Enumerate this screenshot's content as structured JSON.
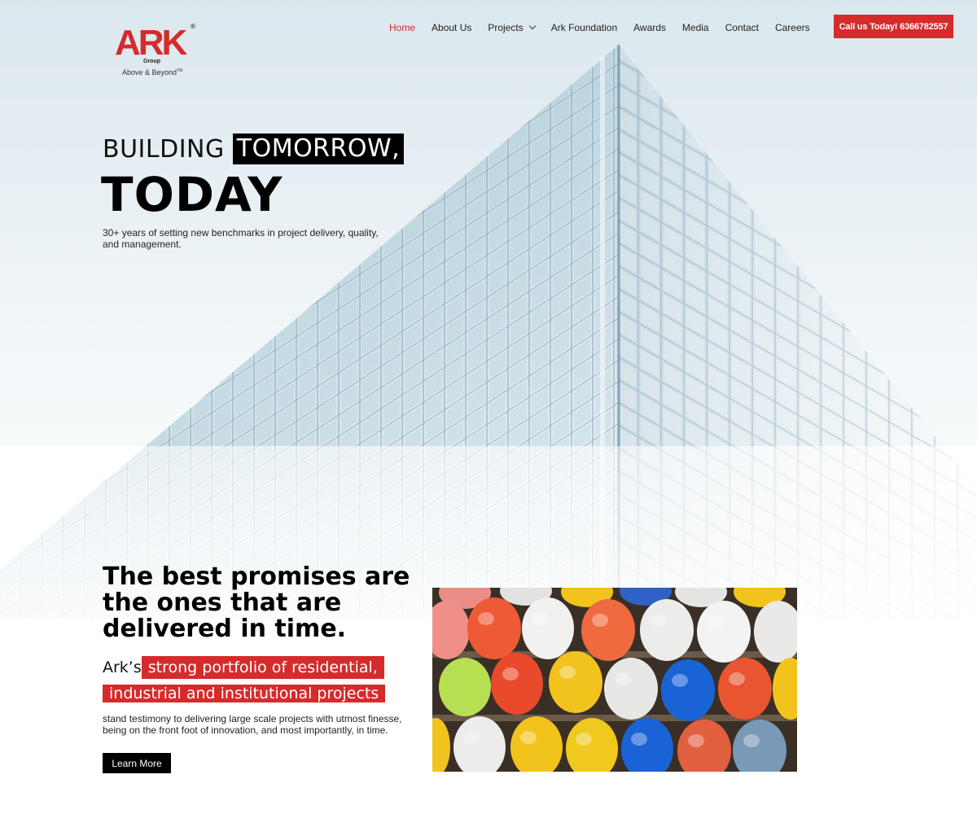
{
  "header": {
    "logo": {
      "text": "ARK",
      "group": "Group",
      "tagline": "Above & Beyond",
      "reg": "®",
      "tm": "TM"
    },
    "nav": [
      {
        "label": "Home",
        "active": true
      },
      {
        "label": "About Us"
      },
      {
        "label": "Projects",
        "has_dropdown": true
      },
      {
        "label": "Ark Foundation"
      },
      {
        "label": "Awards"
      },
      {
        "label": "Media"
      },
      {
        "label": "Contact"
      },
      {
        "label": "Careers"
      }
    ],
    "cta_label": "Call us Today! 6366782557"
  },
  "hero": {
    "line1_plain": "BUILDING",
    "line1_boxed": "TOMORROW,",
    "line2": "TODAY",
    "subtitle": "30+ years of setting new benchmarks in project delivery, quality, and management."
  },
  "promise": {
    "heading": "The best promises are the ones that are delivered in time.",
    "ark_plain": "Ark’s",
    "highlight_1": "strong portfolio of residential,",
    "highlight_2": "industrial and institutional projects",
    "paragraph": "stand testimony to delivering large scale projects with utmost finesse, being on the front foot of innovation, and most importantly, in time.",
    "button_label": "Learn More"
  },
  "colors": {
    "accent": "#d52b2b",
    "dark": "#000000"
  },
  "icons": {
    "dropdown": "chevron-down-icon",
    "image": "hard-hats-image",
    "background": "glass-building-image"
  }
}
